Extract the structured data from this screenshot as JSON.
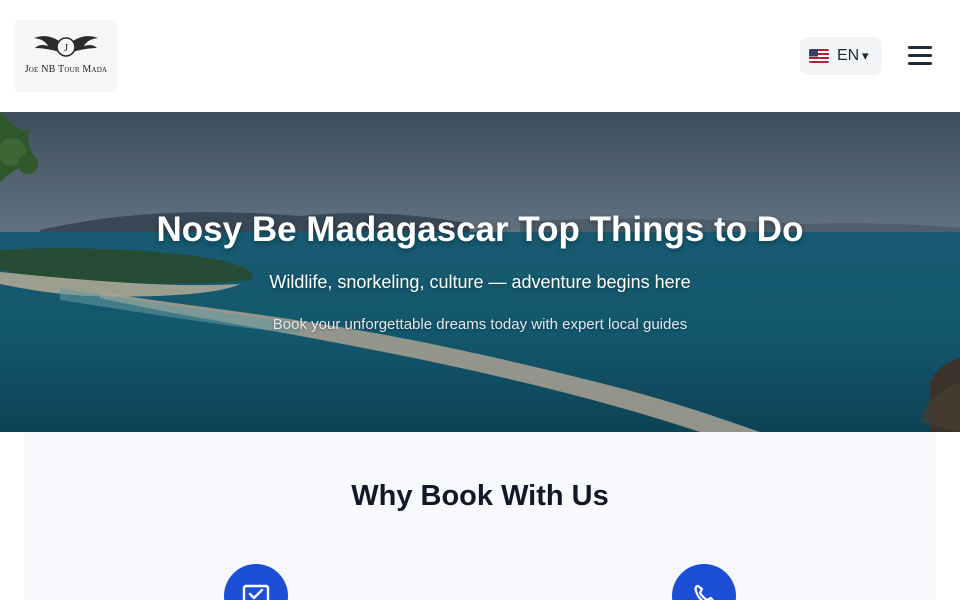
{
  "header": {
    "logo_text": "Joe NB Tour Mada",
    "language": {
      "code": "EN",
      "caret": "▾",
      "flag": "us-flag-icon"
    },
    "menu_icon": "hamburger-menu-icon"
  },
  "hero": {
    "title": "Nosy Be Madagascar Top Things to Do",
    "subtitle": "Wildlife, snorkeling, culture — adventure begins here",
    "tagline": "Book your unforgettable dreams today with expert local guides"
  },
  "why": {
    "title": "Why Book With Us",
    "features": [
      {
        "icon": "checklist-icon"
      },
      {
        "icon": "phone-support-icon"
      }
    ]
  },
  "colors": {
    "accent": "#1d4ed8",
    "text_dark": "#111827",
    "section_bg": "#f7f9fc"
  }
}
